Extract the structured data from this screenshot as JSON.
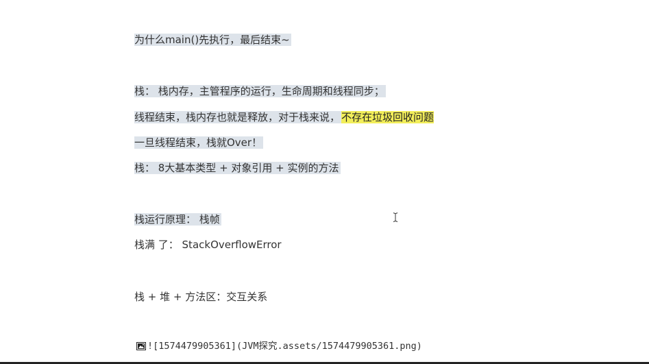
{
  "document": {
    "lines": {
      "l1": "为什么main()先执行，最后结束~",
      "l2": "栈： 栈内存，主管程序的运行，生命周期和线程同步；",
      "l3_prefix": "线程结束，栈内存也就是释放，对于栈来说，",
      "l3_highlight": "不存在垃圾回收问题",
      "l4": "一旦线程结束，栈就Over！",
      "l5": "栈： 8大基本类型 + 对象引用 + 实例的方法",
      "l6": "栈运行原理： 栈帧",
      "l7": "栈满 了： StackOverflowError",
      "l8": "栈 + 堆 + 方法区：交互关系"
    },
    "image_markdown": "![1574479905361](JVM探究.assets/1574479905361.png)"
  },
  "colors": {
    "selection": "#dde3ea",
    "highlight": "#f2ee5a",
    "text": "#333333"
  },
  "icons": {
    "image_placeholder": "broken-image-icon",
    "text_cursor": "i-beam-cursor-icon"
  }
}
